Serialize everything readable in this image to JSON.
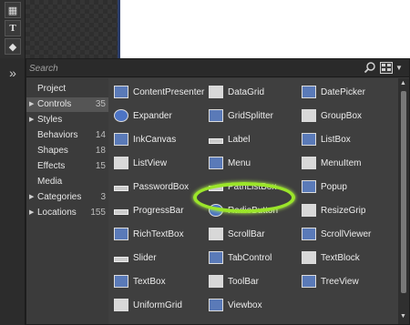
{
  "search": {
    "placeholder": "Search"
  },
  "categories": [
    {
      "label": "Project",
      "count": "",
      "expandable": false,
      "selected": false
    },
    {
      "label": "Controls",
      "count": "35",
      "expandable": true,
      "selected": true
    },
    {
      "label": "Styles",
      "count": "",
      "expandable": true,
      "selected": false
    },
    {
      "label": "Behaviors",
      "count": "14",
      "expandable": false,
      "selected": false
    },
    {
      "label": "Shapes",
      "count": "18",
      "expandable": false,
      "selected": false
    },
    {
      "label": "Effects",
      "count": "15",
      "expandable": false,
      "selected": false
    },
    {
      "label": "Media",
      "count": "",
      "expandable": false,
      "selected": false
    },
    {
      "label": "Categories",
      "count": "3",
      "expandable": true,
      "selected": false
    },
    {
      "label": "Locations",
      "count": "155",
      "expandable": true,
      "selected": false
    }
  ],
  "controls": [
    {
      "label": "ContentPresenter",
      "icon": "content-presenter-icon"
    },
    {
      "label": "DataGrid",
      "icon": "datagrid-icon"
    },
    {
      "label": "DatePicker",
      "icon": "datepicker-icon"
    },
    {
      "label": "Expander",
      "icon": "expander-icon"
    },
    {
      "label": "GridSplitter",
      "icon": "gridsplitter-icon"
    },
    {
      "label": "GroupBox",
      "icon": "groupbox-icon"
    },
    {
      "label": "InkCanvas",
      "icon": "inkcanvas-icon"
    },
    {
      "label": "Label",
      "icon": "label-icon"
    },
    {
      "label": "ListBox",
      "icon": "listbox-icon"
    },
    {
      "label": "ListView",
      "icon": "listview-icon"
    },
    {
      "label": "Menu",
      "icon": "menu-icon"
    },
    {
      "label": "MenuItem",
      "icon": "menuitem-icon"
    },
    {
      "label": "PasswordBox",
      "icon": "passwordbox-icon"
    },
    {
      "label": "PathListBox",
      "icon": "pathlistbox-icon"
    },
    {
      "label": "Popup",
      "icon": "popup-icon"
    },
    {
      "label": "ProgressBar",
      "icon": "progressbar-icon"
    },
    {
      "label": "RadioButton",
      "icon": "radiobutton-icon"
    },
    {
      "label": "ResizeGrip",
      "icon": "resizegrip-icon"
    },
    {
      "label": "RichTextBox",
      "icon": "richtextbox-icon"
    },
    {
      "label": "ScrollBar",
      "icon": "scrollbar-icon"
    },
    {
      "label": "ScrollViewer",
      "icon": "scrollviewer-icon"
    },
    {
      "label": "Slider",
      "icon": "slider-icon"
    },
    {
      "label": "TabControl",
      "icon": "tabcontrol-icon"
    },
    {
      "label": "TextBlock",
      "icon": "textblock-icon"
    },
    {
      "label": "TextBox",
      "icon": "textbox-icon"
    },
    {
      "label": "ToolBar",
      "icon": "toolbar-icon"
    },
    {
      "label": "TreeView",
      "icon": "treeview-icon"
    },
    {
      "label": "UniformGrid",
      "icon": "uniformgrid-icon"
    },
    {
      "label": "Viewbox",
      "icon": "viewbox-icon"
    }
  ],
  "colors": {
    "highlight": "#9be52a",
    "panel": "#3b3b3b",
    "accent": "#4d74c4"
  }
}
